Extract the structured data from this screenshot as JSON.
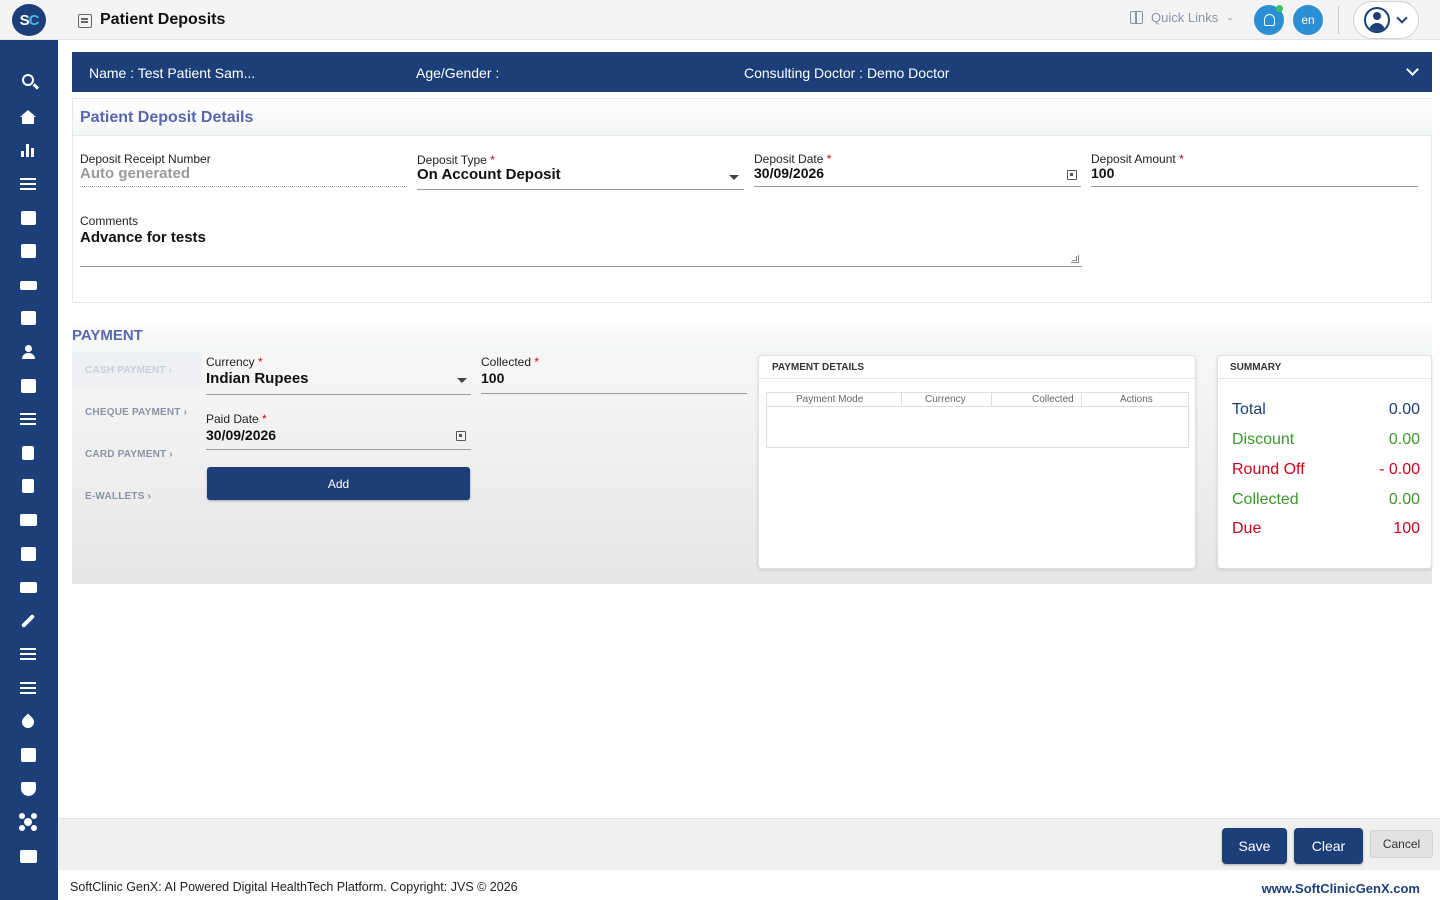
{
  "header": {
    "logo_s": "S",
    "logo_c": "C",
    "page_title": "Patient Deposits",
    "quick_links": "Quick Links",
    "language": "en"
  },
  "banner": {
    "name": "Name :  Test Patient Sam...",
    "age_gender": "Age/Gender :",
    "consulting_doctor": "Consulting Doctor :  Demo Doctor"
  },
  "deposit_details": {
    "section_title": "Patient Deposit Details",
    "receipt_label": "Deposit Receipt Number",
    "receipt_placeholder": "Auto generated",
    "type_label": "Deposit Type",
    "type_value": "On Account Deposit",
    "date_label": "Deposit Date",
    "date_value": "30/09/2026",
    "amount_label": "Deposit Amount",
    "amount_value": "100",
    "comments_label": "Comments",
    "comments_value": "Advance for tests",
    "required_mark": "*"
  },
  "payment": {
    "section_title": "PAYMENT",
    "tabs": [
      {
        "label": "CASH PAYMENT ›"
      },
      {
        "label": "CHEQUE PAYMENT ›"
      },
      {
        "label": "CARD PAYMENT ›"
      },
      {
        "label": "E-WALLETS ›"
      }
    ],
    "currency_label": "Currency",
    "currency_value": "Indian Rupees",
    "collected_label": "Collected",
    "collected_value": "100",
    "paid_date_label": "Paid Date",
    "paid_date_value": "30/09/2026",
    "add_label": "Add"
  },
  "payment_details": {
    "title": "PAYMENT DETAILS",
    "columns": [
      "Payment Mode",
      "Currency",
      "Collected",
      "Actions"
    ]
  },
  "summary": {
    "title": "SUMMARY",
    "rows": [
      {
        "label": "Total",
        "value": "0.00",
        "color": "#1c3f7a"
      },
      {
        "label": "Discount",
        "value": "0.00",
        "color": "#3a9a2a"
      },
      {
        "label": "Round Off",
        "value": "- 0.00",
        "color": "#d0021b"
      },
      {
        "label": "Collected",
        "value": "0.00",
        "color": "#3a9a2a"
      },
      {
        "label": "Due",
        "value": "100",
        "color": "#d0021b"
      }
    ]
  },
  "actions": {
    "save": "Save",
    "clear": "Clear",
    "cancel": "Cancel"
  },
  "footer": {
    "copyright": "SoftClinic GenX: AI Powered Digital HealthTech Platform. Copyright: JVS © 2026",
    "website": "www.SoftClinicGenX.com"
  },
  "colors": {
    "brand": "#1c3f7a",
    "accent": "#2a8fd4",
    "section_title": "#5a67b0"
  }
}
